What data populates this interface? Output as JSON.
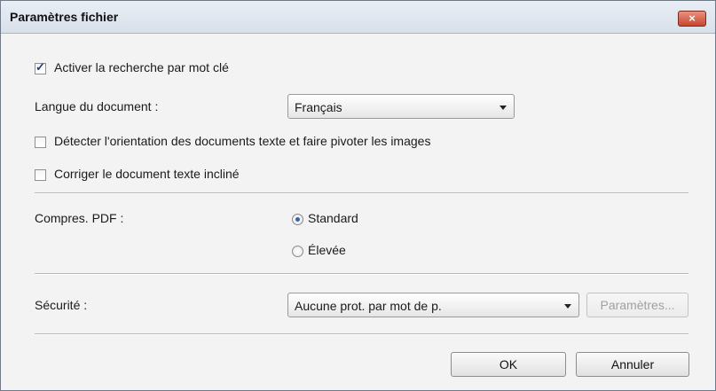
{
  "window": {
    "title": "Paramètres fichier",
    "close_label": "×"
  },
  "keyword_search": {
    "label": "Activer la recherche par mot clé",
    "checked": true
  },
  "document_language": {
    "label": "Langue du document :",
    "selected": "Français"
  },
  "detect_orientation": {
    "label": "Détecter l'orientation des documents texte et faire pivoter les images",
    "checked": false
  },
  "correct_skew": {
    "label": "Corriger le document texte incliné",
    "checked": false
  },
  "pdf_compression": {
    "label": "Compres. PDF :",
    "options": [
      {
        "label": "Standard",
        "selected": true
      },
      {
        "label": "Élevée",
        "selected": false
      }
    ]
  },
  "security": {
    "label": "Sécurité :",
    "selected": "Aucune prot. par mot de p.",
    "settings_button": "Paramètres..."
  },
  "footer": {
    "ok_label": "OK",
    "cancel_label": "Annuler"
  },
  "colors": {
    "titlebar": "#dfe6ef",
    "close_button": "#d2543d",
    "radio_dot": "#2f64b5"
  }
}
